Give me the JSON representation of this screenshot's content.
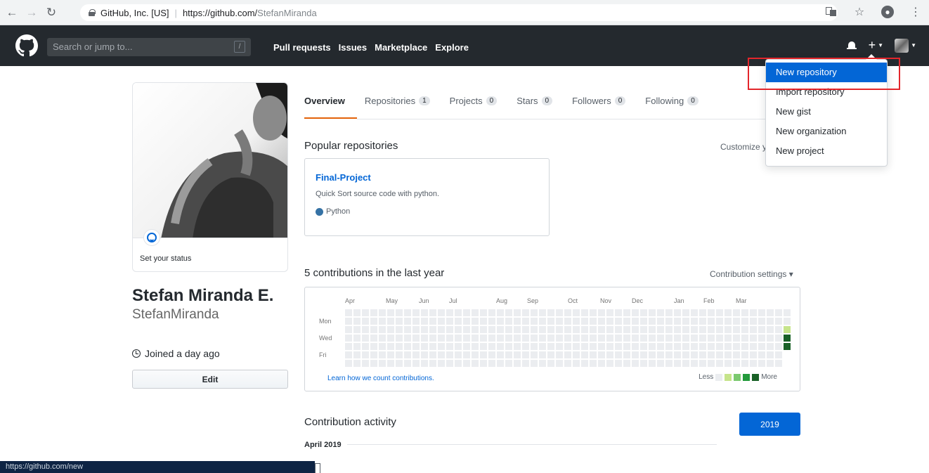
{
  "browser": {
    "site_identity": "GitHub, Inc. [US]",
    "url_domain": "https://github.com/",
    "url_path": "StefanMiranda"
  },
  "header": {
    "search_placeholder": "Search or jump to...",
    "slash_key": "/",
    "nav": [
      "Pull requests",
      "Issues",
      "Marketplace",
      "Explore"
    ]
  },
  "dropdown": {
    "items": [
      "New repository",
      "Import repository",
      "New gist",
      "New organization",
      "New project"
    ],
    "active_index": 0
  },
  "profile": {
    "status_text": "Set your status",
    "full_name": "Stefan Miranda E.",
    "username": "StefanMiranda",
    "joined": "Joined a day ago",
    "edit_label": "Edit"
  },
  "tabs": [
    {
      "label": "Overview",
      "count": ""
    },
    {
      "label": "Repositories",
      "count": "1"
    },
    {
      "label": "Projects",
      "count": "0"
    },
    {
      "label": "Stars",
      "count": "0"
    },
    {
      "label": "Followers",
      "count": "0"
    },
    {
      "label": "Following",
      "count": "0"
    }
  ],
  "popular": {
    "title": "Popular repositories",
    "customize": "Customize y",
    "repo": {
      "name": "Final-Project",
      "description": "Quick Sort source code with python.",
      "language": "Python",
      "language_color": "#3572a5"
    }
  },
  "contributions": {
    "title": "5 contributions in the last year",
    "settings": "Contribution settings ▾",
    "months": [
      "Apr",
      "May",
      "Jun",
      "Jul",
      "Aug",
      "Sep",
      "Oct",
      "Nov",
      "Dec",
      "Jan",
      "Feb",
      "Mar"
    ],
    "days": [
      "Mon",
      "Wed",
      "Fri"
    ],
    "learn_link": "Learn how we count contributions.",
    "legend_less": "Less",
    "legend_more": "More",
    "colors": [
      "#ebedf0",
      "#c6e48b",
      "#7bc96f",
      "#239a3b",
      "#196127"
    ],
    "active_cells": [
      {
        "week": 52,
        "day": 2,
        "level": 1
      },
      {
        "week": 52,
        "day": 3,
        "level": 4
      },
      {
        "week": 52,
        "day": 4,
        "level": 4
      }
    ]
  },
  "activity": {
    "title": "Contribution activity",
    "year": "2019",
    "month": "April 2019"
  },
  "status_bar": {
    "url": "https://github.com/new"
  }
}
